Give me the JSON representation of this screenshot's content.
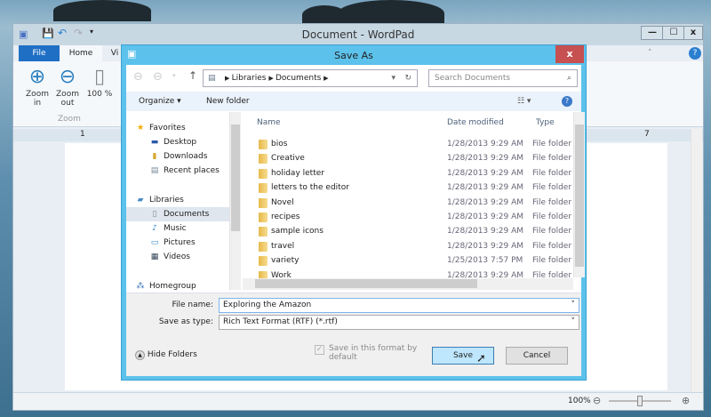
{
  "wordpad": {
    "title": "Document - WordPad",
    "min": "—",
    "max": "☐",
    "close": "x",
    "tabs": {
      "file": "File",
      "home": "Home",
      "view": "Vi"
    },
    "ribbon": {
      "zoom_in": "Zoom in",
      "zoom_out": "Zoom out",
      "hundred": "100 %",
      "group": "Zoom"
    },
    "ruler": {
      "left": "1",
      "right": "7"
    },
    "status": {
      "zoom": "100%"
    },
    "zoom_level": 0.5
  },
  "dialog": {
    "title": "Save As",
    "close": "x",
    "address": {
      "parts": [
        "Libraries",
        "Documents"
      ]
    },
    "search_placeholder": "Search Documents",
    "toolbar": {
      "organize": "Organize ▾",
      "new_folder": "New folder"
    },
    "nav": {
      "favorites": "Favorites",
      "desktop": "Desktop",
      "downloads": "Downloads",
      "recent": "Recent places",
      "libraries": "Libraries",
      "documents": "Documents",
      "music": "Music",
      "pictures": "Pictures",
      "videos": "Videos",
      "homegroup": "Homegroup"
    },
    "columns": {
      "name": "Name",
      "date": "Date modified",
      "type": "Type"
    },
    "files": [
      {
        "name": "bios",
        "date": "1/28/2013 9:29 AM",
        "type": "File folder"
      },
      {
        "name": "Creative",
        "date": "1/28/2013 9:29 AM",
        "type": "File folder"
      },
      {
        "name": "holiday letter",
        "date": "1/28/2013 9:29 AM",
        "type": "File folder"
      },
      {
        "name": "letters to the editor",
        "date": "1/28/2013 9:29 AM",
        "type": "File folder"
      },
      {
        "name": "Novel",
        "date": "1/28/2013 9:29 AM",
        "type": "File folder"
      },
      {
        "name": "recipes",
        "date": "1/28/2013 9:29 AM",
        "type": "File folder"
      },
      {
        "name": "sample icons",
        "date": "1/28/2013 9:29 AM",
        "type": "File folder"
      },
      {
        "name": "travel",
        "date": "1/28/2013 9:29 AM",
        "type": "File folder"
      },
      {
        "name": "variety",
        "date": "1/25/2013 7:57 PM",
        "type": "File folder"
      },
      {
        "name": "Work",
        "date": "1/28/2013 9:29 AM",
        "type": "File folder"
      }
    ],
    "file_name_label": "File name:",
    "file_name": "Exploring the Amazon",
    "type_label": "Save as type:",
    "type_value": "Rich Text Format (RTF) (*.rtf)",
    "default_check": "Save in this format by default",
    "hide_folders": "Hide Folders",
    "save": "Save",
    "cancel": "Cancel"
  }
}
